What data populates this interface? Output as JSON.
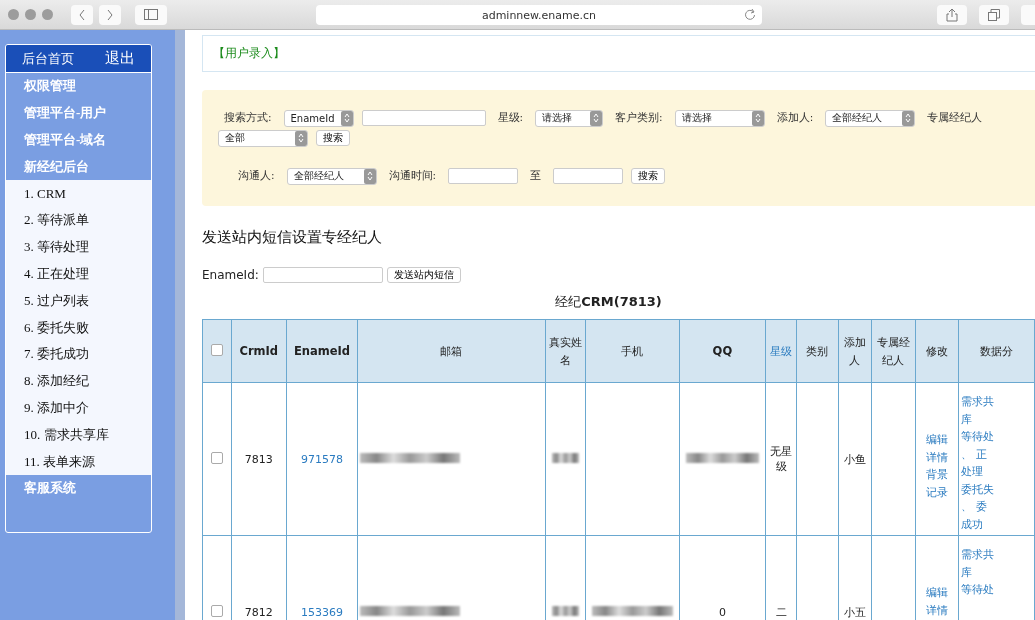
{
  "browser": {
    "url": "adminnew.ename.cn"
  },
  "sidebar": {
    "header": [
      {
        "label": "后台首页"
      },
      {
        "label": "退出"
      }
    ],
    "items": [
      {
        "label": "权限管理",
        "kind": "section"
      },
      {
        "label": "管理平台-用户",
        "kind": "section"
      },
      {
        "label": "管理平台-域名",
        "kind": "section"
      },
      {
        "label": "新经纪后台",
        "kind": "section"
      },
      {
        "label": "1. CRM",
        "kind": "sub"
      },
      {
        "label": "2. 等待派单",
        "kind": "sub"
      },
      {
        "label": "3. 等待处理",
        "kind": "sub"
      },
      {
        "label": "4. 正在处理",
        "kind": "sub"
      },
      {
        "label": "5. 过户列表",
        "kind": "sub"
      },
      {
        "label": "6. 委托失败",
        "kind": "sub"
      },
      {
        "label": "7. 委托成功",
        "kind": "sub"
      },
      {
        "label": "8. 添加经纪",
        "kind": "sub"
      },
      {
        "label": "9. 添加中介",
        "kind": "sub"
      },
      {
        "label": "10. 需求共享库",
        "kind": "sub"
      },
      {
        "label": "11. 表单来源",
        "kind": "sub"
      },
      {
        "label": "客服系统",
        "kind": "section"
      }
    ]
  },
  "breadcrumb": "【用户录入】",
  "search": {
    "lines": [
      {
        "controls": [
          {
            "kind": "label",
            "text": "搜索方式:"
          },
          {
            "kind": "select",
            "value": "EnameId"
          },
          {
            "kind": "input"
          },
          {
            "kind": "label",
            "text": "星级:"
          },
          {
            "kind": "select",
            "value": "请选择"
          },
          {
            "kind": "label",
            "text": "客户类别:"
          },
          {
            "kind": "select",
            "value": "请选择"
          },
          {
            "kind": "label",
            "text": "添加人:"
          },
          {
            "kind": "select",
            "value": "全部经纪人"
          },
          {
            "kind": "label",
            "text": "专属经纪人"
          }
        ]
      },
      {
        "controls": [
          {
            "kind": "select",
            "value": "全部"
          },
          {
            "kind": "button",
            "text": "搜索"
          }
        ]
      },
      {
        "controls": [
          {
            "kind": "label",
            "text": "沟通人:"
          },
          {
            "kind": "select",
            "value": "全部经纪人"
          },
          {
            "kind": "label",
            "text": "沟通时间:"
          },
          {
            "kind": "input"
          },
          {
            "kind": "label",
            "text": "至"
          },
          {
            "kind": "input"
          },
          {
            "kind": "button",
            "text": "搜索"
          }
        ]
      }
    ]
  },
  "message": {
    "title": "发送站内短信设置专经纪人",
    "label": "EnameId:",
    "button": "发送站内短信"
  },
  "table": {
    "caption_prefix": "经纪",
    "caption_bold": "CRM(7813)",
    "columns": [
      {
        "kind": "checkbox",
        "checked": false
      },
      {
        "label": "CrmId",
        "kind": "bold"
      },
      {
        "label": "EnameId",
        "kind": "bold"
      },
      {
        "label": "邮箱",
        "kind": "text"
      },
      {
        "label": "真实姓名",
        "kind": "text"
      },
      {
        "label": "手机",
        "kind": "text"
      },
      {
        "label": "QQ",
        "kind": "bold"
      },
      {
        "label": "星级",
        "kind": "link"
      },
      {
        "label": "类别",
        "kind": "text"
      },
      {
        "label": "添加人",
        "kind": "text"
      },
      {
        "label": "专属经纪人",
        "kind": "text"
      },
      {
        "label": "修改",
        "kind": "text"
      },
      {
        "label": "数据分",
        "kind": "text"
      }
    ],
    "rows": [
      {
        "cells": [
          {
            "kind": "checkbox",
            "checked": false
          },
          {
            "kind": "text",
            "text": "7813"
          },
          {
            "kind": "link",
            "text": "971578"
          },
          {
            "kind": "redacted"
          },
          {
            "kind": "redacted"
          },
          {
            "kind": "empty"
          },
          {
            "kind": "redacted"
          },
          {
            "kind": "text",
            "text": "无星级"
          },
          {
            "kind": "empty"
          },
          {
            "kind": "text",
            "text": "小鱼"
          },
          {
            "kind": "empty"
          },
          {
            "kind": "links",
            "items": [
              "编辑",
              "详情",
              "背景",
              "记录"
            ]
          },
          {
            "kind": "links",
            "items": [
              "需求共",
              "库",
              "等待处",
              "、 正",
              "处理",
              "委托失",
              "、 委",
              "成功"
            ]
          }
        ]
      },
      {
        "cells": [
          {
            "kind": "checkbox",
            "checked": false
          },
          {
            "kind": "text",
            "text": "7812"
          },
          {
            "kind": "link",
            "text": "153369"
          },
          {
            "kind": "redacted"
          },
          {
            "kind": "redacted"
          },
          {
            "kind": "redacted"
          },
          {
            "kind": "text",
            "text": "0"
          },
          {
            "kind": "text",
            "text": "二"
          },
          {
            "kind": "empty"
          },
          {
            "kind": "text",
            "text": "小五"
          },
          {
            "kind": "empty"
          },
          {
            "kind": "links",
            "items": [
              "编辑",
              "详情"
            ]
          },
          {
            "kind": "links",
            "items": [
              "需求共",
              "库",
              "等待处"
            ]
          }
        ]
      }
    ]
  }
}
